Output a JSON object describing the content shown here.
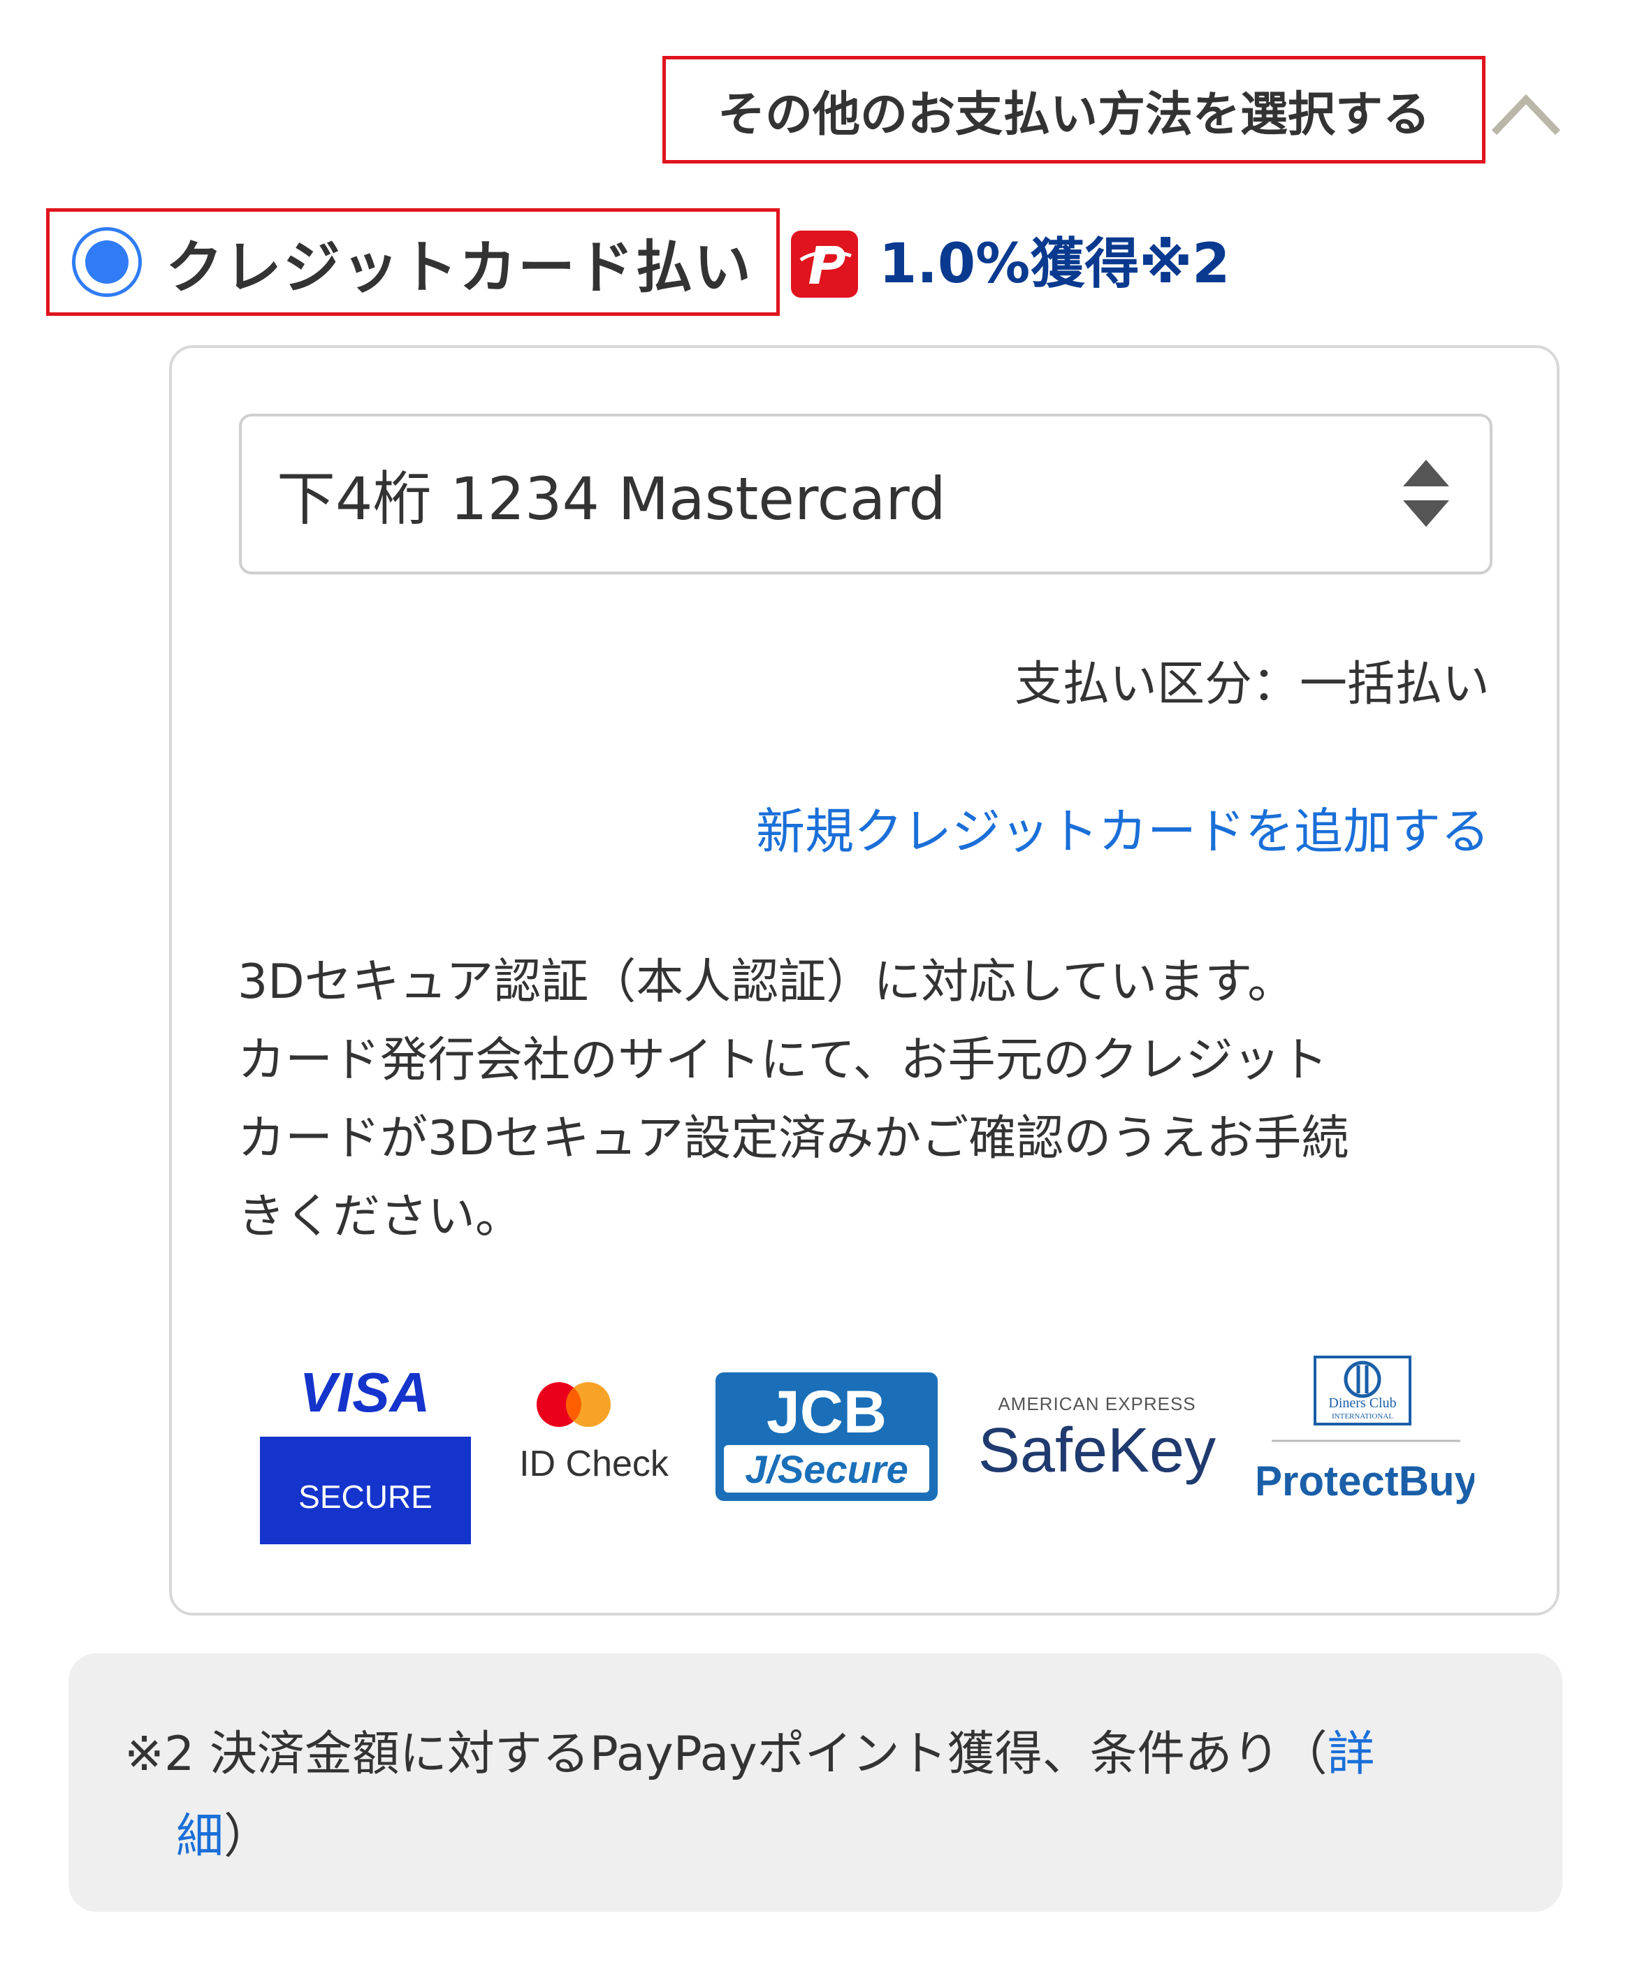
{
  "header": {
    "other_methods_label": "その他のお支払い方法を選択する",
    "toggle_icon": "chevron-up-icon"
  },
  "payment": {
    "credit_card_label": "クレジットカード払い",
    "selected": true,
    "paypay_points": "1.0%獲得※2",
    "brand_color": "#e0141e",
    "accent_color": "#2f7cf6"
  },
  "card_panel": {
    "selected_card": "下4桁 1234 Mastercard",
    "payment_division": "支払い区分：一括払い",
    "add_card_link": "新規クレジットカードを追加する",
    "secure_lines": [
      "3Dセキュア認証（本人認証）に対応しています。",
      "カード発行会社のサイトにて、お手元のクレジット",
      "カードが3Dセキュア設定済みかご確認のうえお手続",
      "きください。"
    ],
    "logos": {
      "visa_top": "VISA",
      "visa_bottom": "SECURE",
      "mastercard": "ID Check",
      "jcb_top": "JCB",
      "jcb_bottom": "J/Secure",
      "amex_top": "AMERICAN EXPRESS",
      "amex_main": "SafeKey",
      "diners_top": "Diners Club",
      "diners_sub": "INTERNATIONAL",
      "diners_main": "ProtectBuy"
    }
  },
  "footnote": {
    "text_line1": "※2 決済金額に対するPayPayポイント獲得、条件あり（",
    "link_part1": "詳",
    "link_part2": "細",
    "text_end": "）"
  }
}
